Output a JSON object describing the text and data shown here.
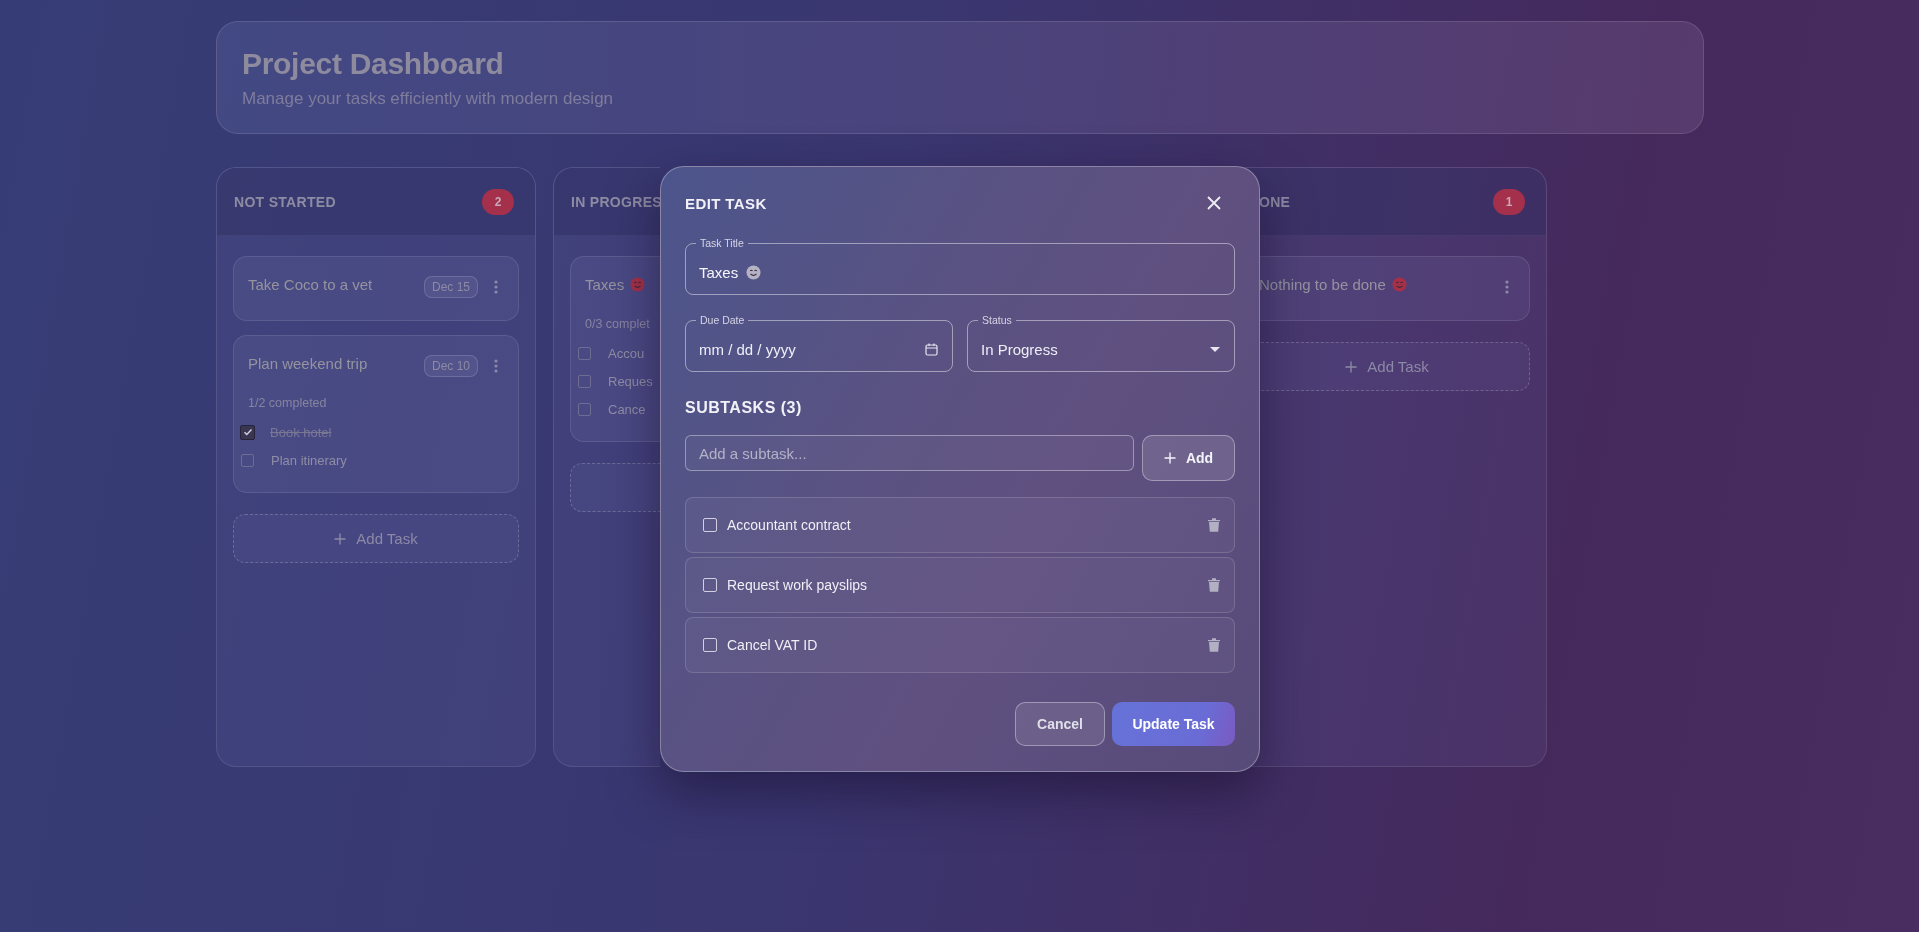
{
  "header": {
    "title": "Project Dashboard",
    "subtitle": "Manage your tasks efficiently with modern design"
  },
  "columns": [
    {
      "title": "NOT STARTED",
      "count": "2",
      "add_task": true,
      "add_label": "Add Task",
      "tasks": [
        {
          "title": "Take Coco to a vet",
          "due": "Dec 15",
          "emoji": false,
          "menu": true
        },
        {
          "title": "Plan weekend trip",
          "due": "Dec 10",
          "emoji": false,
          "menu": true,
          "progress": "1/2 completed",
          "subtasks": [
            {
              "label": "Book hotel",
              "checked": true
            },
            {
              "label": "Plan itinerary",
              "checked": false
            }
          ]
        }
      ]
    },
    {
      "title": "IN PROGRES",
      "add_task": true,
      "tasks": [
        {
          "title": "Taxes",
          "emoji": true,
          "menu": false,
          "progress": "0/3 complet",
          "subtasks": [
            {
              "label": "Accou",
              "checked": false
            },
            {
              "label": "Reques",
              "checked": false
            },
            {
              "label": "Cance",
              "checked": false
            }
          ]
        }
      ]
    },
    {
      "title": "ONE",
      "clipped_start": true,
      "count": "1",
      "add_task": true,
      "add_label": "Add Task",
      "tasks": [
        {
          "title": "Nothing to be done",
          "emoji": true,
          "menu": true
        }
      ]
    }
  ],
  "modal": {
    "title": "EDIT TASK",
    "task_title": {
      "label": "Task Title",
      "value": "Taxes",
      "emoji": true
    },
    "due_date": {
      "label": "Due Date",
      "placeholder": "mm / dd / yyyy"
    },
    "status": {
      "label": "Status",
      "value": "In Progress"
    },
    "subtasks_heading": "SUBTASKS (3)",
    "new_subtask": {
      "placeholder": "Add a subtask..."
    },
    "add_button": "Add",
    "subtasks": [
      {
        "label": "Accountant contract",
        "checked": false
      },
      {
        "label": "Request work payslips",
        "checked": false
      },
      {
        "label": "Cancel VAT ID",
        "checked": false
      }
    ],
    "buttons": [
      {
        "label": "Cancel",
        "kind": "secondary"
      },
      {
        "label": "Update Task",
        "kind": "primary"
      }
    ]
  }
}
